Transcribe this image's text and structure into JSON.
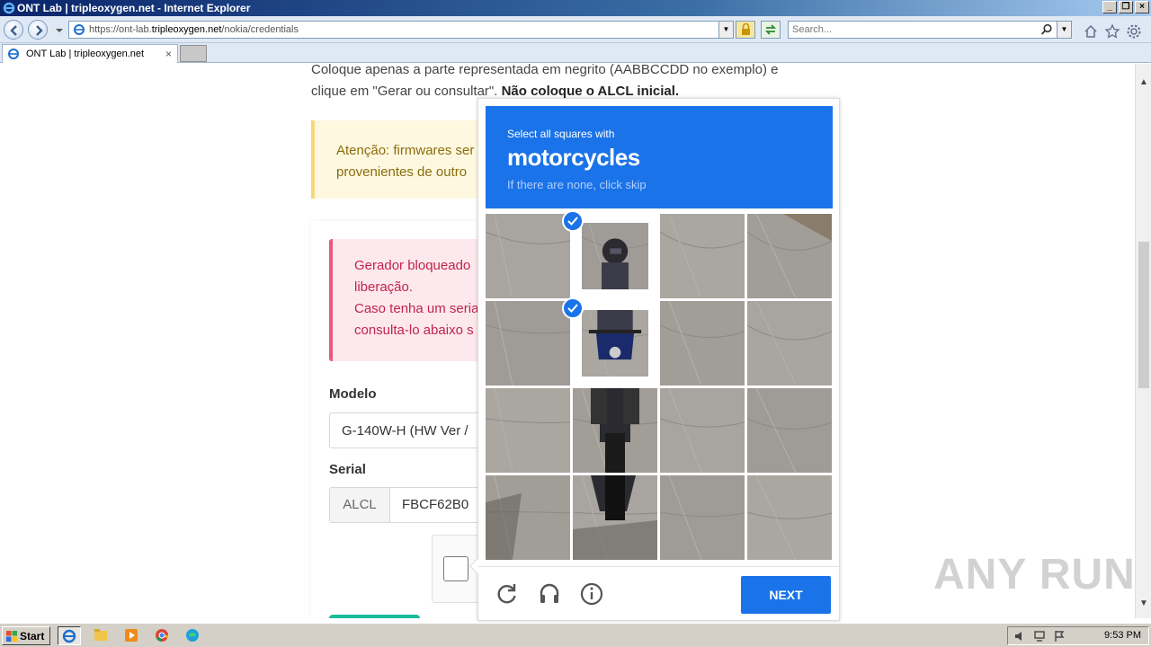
{
  "window": {
    "title": "ONT Lab | tripleoxygen.net - Internet Explorer",
    "controls": [
      "_",
      "❐",
      "×"
    ]
  },
  "nav": {
    "url_prefix": "https://ont-lab.",
    "url_domain": "tripleoxygen.net",
    "url_path": "/nokia/credentials",
    "search_placeholder": "Search..."
  },
  "tab": {
    "label": "ONT Lab | tripleoxygen.net",
    "close": "×"
  },
  "page": {
    "intro_line1": "Coloque apenas a parte representada em negrito (AABBCCDD no exemplo) e",
    "intro_line2_a": "clique em \"Gerar ou consultar\". ",
    "intro_line2_b": "Não coloque o ALCL inicial.",
    "warning_line1": "Atenção: firmwares ser",
    "warning_line2": "provenientes de outro",
    "danger_line1": "Gerador bloqueado",
    "danger_line2": "liberação.",
    "danger_line3": "Caso tenha um seria",
    "danger_line4": "consulta-lo abaixo s",
    "modelo_label": "Modelo",
    "modelo_value": "G-140W-H (HW Ver /",
    "serial_label": "Serial",
    "serial_prefix": "ALCL",
    "serial_value": "FBCF62B0"
  },
  "captcha": {
    "instruction_small": "Select all squares with",
    "target": "motorcycles",
    "hint": "If there are none, click skip",
    "next_label": "NEXT",
    "cells": [
      {
        "row": 0,
        "col": 0,
        "selected": false,
        "motorcycle": false
      },
      {
        "row": 0,
        "col": 1,
        "selected": true,
        "motorcycle": true
      },
      {
        "row": 0,
        "col": 2,
        "selected": false,
        "motorcycle": false
      },
      {
        "row": 0,
        "col": 3,
        "selected": false,
        "motorcycle": false
      },
      {
        "row": 1,
        "col": 0,
        "selected": false,
        "motorcycle": false
      },
      {
        "row": 1,
        "col": 1,
        "selected": true,
        "motorcycle": true
      },
      {
        "row": 1,
        "col": 2,
        "selected": false,
        "motorcycle": false
      },
      {
        "row": 1,
        "col": 3,
        "selected": false,
        "motorcycle": false
      },
      {
        "row": 2,
        "col": 0,
        "selected": false,
        "motorcycle": false
      },
      {
        "row": 2,
        "col": 1,
        "selected": false,
        "motorcycle": true
      },
      {
        "row": 2,
        "col": 2,
        "selected": false,
        "motorcycle": false
      },
      {
        "row": 2,
        "col": 3,
        "selected": false,
        "motorcycle": false
      },
      {
        "row": 3,
        "col": 0,
        "selected": false,
        "motorcycle": false
      },
      {
        "row": 3,
        "col": 1,
        "selected": false,
        "motorcycle": true
      },
      {
        "row": 3,
        "col": 2,
        "selected": false,
        "motorcycle": false
      },
      {
        "row": 3,
        "col": 3,
        "selected": false,
        "motorcycle": false
      }
    ],
    "footer_icons": [
      "refresh-icon",
      "audio-icon",
      "info-icon"
    ],
    "accent": "#1a73e8"
  },
  "watermark": "ANY RUN",
  "taskbar": {
    "start_label": "Start",
    "apps": [
      "internet-explorer-icon",
      "file-explorer-icon",
      "media-player-icon",
      "chrome-icon",
      "edge-icon"
    ],
    "clock": "9:53 PM"
  }
}
